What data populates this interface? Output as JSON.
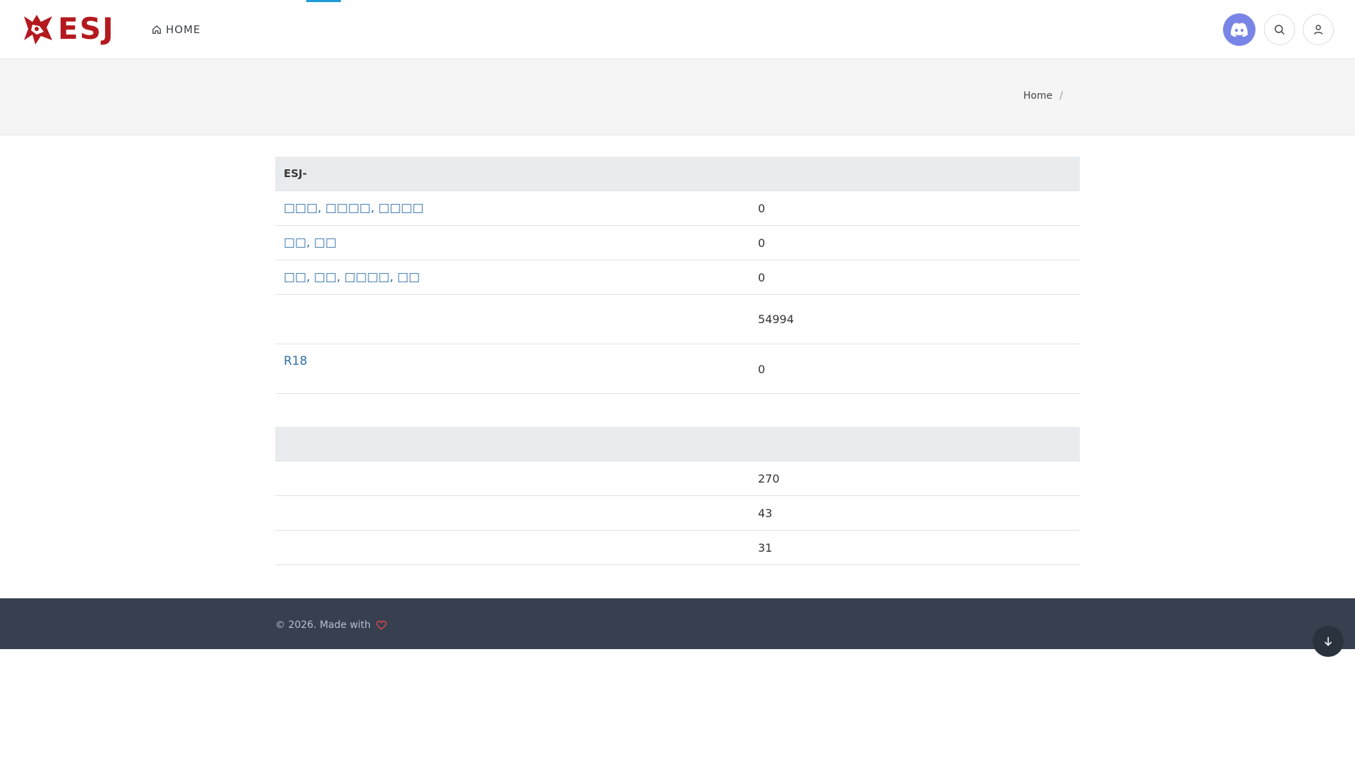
{
  "header": {
    "logo_text": "ESJ",
    "nav_home": "HOME"
  },
  "breadcrumb": {
    "home": "Home",
    "separator": "/"
  },
  "table1": {
    "title": "ESJ-",
    "rows": [
      {
        "label": "□□□, □□□□, □□□□",
        "value": "0"
      },
      {
        "label": "□□, □□",
        "value": "0"
      },
      {
        "label": "□□, □□, □□□□, □□",
        "value": "0"
      },
      {
        "label": "",
        "value": "54994"
      },
      {
        "label": "R18",
        "value": "0"
      }
    ]
  },
  "table2": {
    "title": "",
    "rows": [
      {
        "label": "",
        "value": "270"
      },
      {
        "label": "",
        "value": "43"
      },
      {
        "label": "",
        "value": "31"
      }
    ]
  },
  "footer": {
    "text": "© 2026. Made with"
  },
  "colors": {
    "brand": "#b3191e",
    "discord": "#7985e6",
    "link": "#2e6fa6",
    "footer_bg": "#36404f",
    "nav_active": "#1e9bd7"
  },
  "icons": {
    "home": "home-icon",
    "discord": "discord-icon",
    "search": "search-icon",
    "user": "user-icon",
    "settings": "gear-icon",
    "heart": "heart-icon",
    "scroll": "arrow-down-icon"
  }
}
